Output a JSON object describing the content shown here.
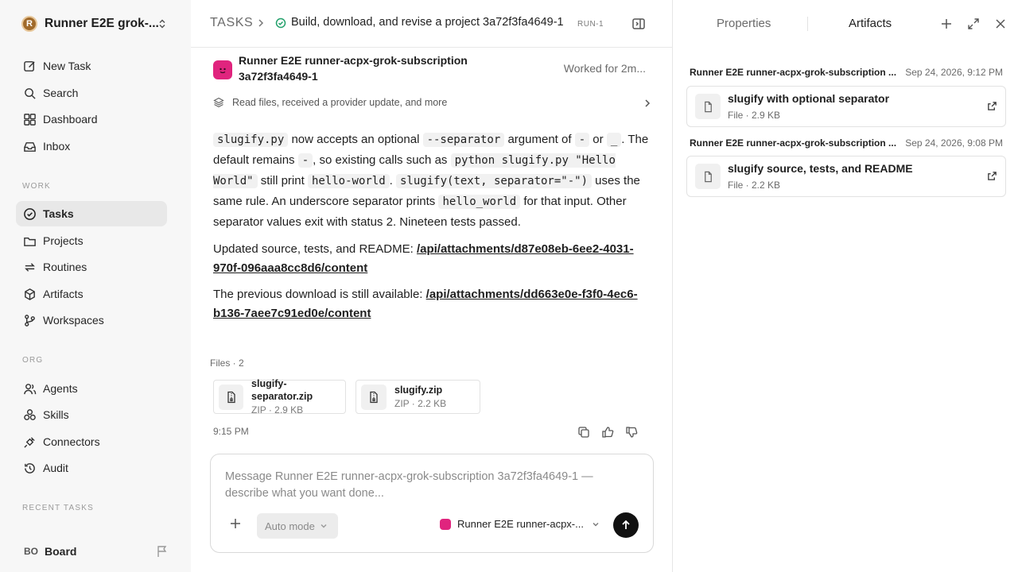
{
  "workspace": {
    "logo_letter": "R",
    "name": "Runner E2E grok-..."
  },
  "nav": {
    "top": [
      {
        "label": "New Task",
        "icon": "compose-icon"
      },
      {
        "label": "Search",
        "icon": "search-icon"
      },
      {
        "label": "Dashboard",
        "icon": "dashboard-icon"
      },
      {
        "label": "Inbox",
        "icon": "inbox-icon"
      }
    ],
    "work_label": "WORK",
    "work": [
      {
        "label": "Tasks",
        "icon": "check-circle-icon",
        "active": true
      },
      {
        "label": "Projects",
        "icon": "folder-icon"
      },
      {
        "label": "Routines",
        "icon": "repeat-icon"
      },
      {
        "label": "Artifacts",
        "icon": "cube-icon"
      },
      {
        "label": "Workspaces",
        "icon": "branch-icon"
      }
    ],
    "org_label": "ORG",
    "org": [
      {
        "label": "Agents",
        "icon": "users-icon"
      },
      {
        "label": "Skills",
        "icon": "skills-icon"
      },
      {
        "label": "Connectors",
        "icon": "plug-icon"
      },
      {
        "label": "Audit",
        "icon": "history-icon"
      }
    ],
    "recent_label": "RECENT TASKS"
  },
  "user": {
    "initials": "BO",
    "name": "Board"
  },
  "header": {
    "section": "TASKS",
    "title": "Build, download, and revise a project 3a72f3fa4649-1",
    "run": "RUN-1"
  },
  "message": {
    "agent_name": "Runner E2E runner-acpx-grok-subscription 3a72f3fa4649-1",
    "worked": "Worked for 2m...",
    "summary": "Read files, received a provider update, and more",
    "p1": [
      {
        "code": "slugify.py"
      },
      {
        "text": " now accepts an optional "
      },
      {
        "code": "--separator"
      },
      {
        "text": " argument of "
      },
      {
        "code": "-"
      },
      {
        "text": " or "
      },
      {
        "code": "_"
      },
      {
        "text": ". The default remains "
      },
      {
        "code": "-"
      },
      {
        "text": ", so existing calls such as "
      },
      {
        "code": "python slugify.py \"Hello World\""
      },
      {
        "text": " still print "
      },
      {
        "code": "hello-world"
      },
      {
        "text": ". "
      },
      {
        "code": "slugify(text, separator=\"-\")"
      },
      {
        "text": " uses the same rule. An underscore separator prints "
      },
      {
        "code": "hello_world"
      },
      {
        "text": " for that input. Other separator values exit with status 2. Nineteen tests passed."
      }
    ],
    "p2_text": "Updated source, tests, and README: ",
    "p2_link": "/api/attachments/d87e08eb-6ee2-4031-970f-096aaa8cc8d6/content",
    "p3_text": "The previous download is still available: ",
    "p3_link": "/api/attachments/dd663e0e-f3f0-4ec6-b136-7aee7c91ed0e/content",
    "files_label": "Files · 2",
    "files": [
      {
        "name": "slugify-separator.zip",
        "meta": "ZIP · 2.9 KB"
      },
      {
        "name": "slugify.zip",
        "meta": "ZIP · 2.2 KB"
      }
    ],
    "time": "9:15 PM"
  },
  "composer": {
    "placeholder": "Message Runner E2E runner-acpx-grok-subscription 3a72f3fa4649-1 — describe what you want done...",
    "mode": "Auto mode",
    "agent": "Runner E2E runner-acpx-..."
  },
  "right_panel": {
    "tabs": {
      "properties": "Properties",
      "artifacts": "Artifacts"
    },
    "groups": [
      {
        "title": "Runner E2E runner-acpx-grok-subscription ...",
        "date": "Sep 24, 2026, 9:12 PM",
        "item": {
          "name": "slugify with optional separator",
          "meta": "File · 2.9 KB"
        }
      },
      {
        "title": "Runner E2E runner-acpx-grok-subscription ...",
        "date": "Sep 24, 2026, 9:08 PM",
        "item": {
          "name": "slugify source, tests, and README",
          "meta": "File · 2.2 KB"
        }
      }
    ]
  },
  "colors": {
    "agent_avatar": "#e0247e",
    "status_ok": "#22a06b",
    "sidebar_bg": "#f7f7f7"
  }
}
